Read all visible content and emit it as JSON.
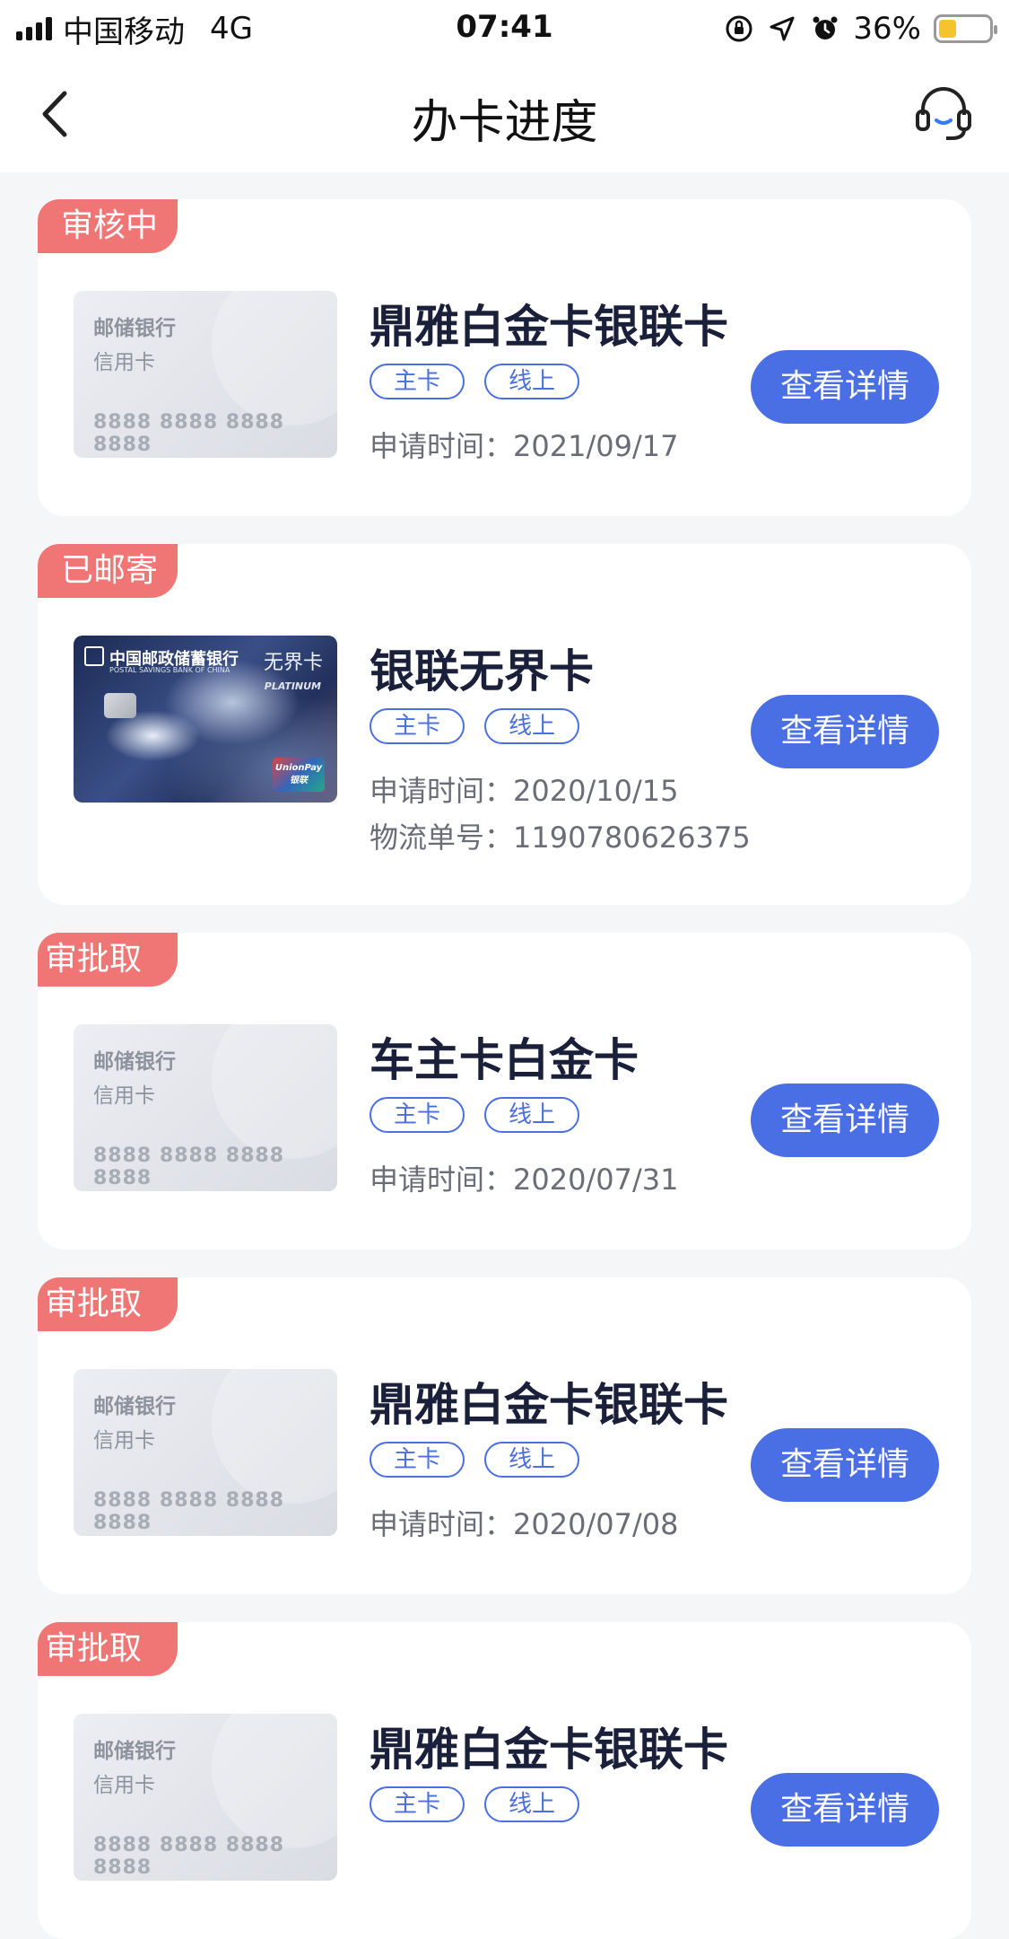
{
  "status_bar": {
    "carrier": "中国移动",
    "network": "4G",
    "time": "07:41",
    "battery": "36%",
    "battery_level": 0.36,
    "icons": [
      "orientation-lock-icon",
      "location-icon",
      "alarm-icon"
    ]
  },
  "nav": {
    "title": "办卡进度",
    "back_icon": "chevron-left-icon",
    "support_icon": "headset-icon"
  },
  "labels": {
    "apply_time": "申请时间：",
    "tracking_number": "物流单号："
  },
  "cards": [
    {
      "status": "审核中",
      "name": "鼎雅白金卡银联卡",
      "tags": [
        "主卡",
        "线上"
      ],
      "apply_time": "2021/09/17",
      "image": {
        "style": "placeholder",
        "bank": "邮储银行",
        "type": "信用卡",
        "number": "8888 8888 8888 8888"
      },
      "button": "查看详情"
    },
    {
      "status": "已邮寄",
      "name": "银联无界卡",
      "tags": [
        "主卡",
        "线上"
      ],
      "apply_time": "2020/10/15",
      "tracking_number": "1190780626375",
      "image": {
        "style": "art",
        "bank": "中国邮政储蓄银行",
        "bank_en": "POSTAL SAVINGS BANK OF CHINA",
        "card_name": "无界卡",
        "tier": "PLATINUM",
        "network": "UnionPay 银联"
      },
      "button": "查看详情"
    },
    {
      "status": "审批取消",
      "name": "车主卡白金卡",
      "tags": [
        "主卡",
        "线上"
      ],
      "apply_time": "2020/07/31",
      "image": {
        "style": "placeholder",
        "bank": "邮储银行",
        "type": "信用卡",
        "number": "8888 8888 8888 8888"
      },
      "button": "查看详情"
    },
    {
      "status": "审批取消",
      "name": "鼎雅白金卡银联卡",
      "tags": [
        "主卡",
        "线上"
      ],
      "apply_time": "2020/07/08",
      "image": {
        "style": "placeholder",
        "bank": "邮储银行",
        "type": "信用卡",
        "number": "8888 8888 8888 8888"
      },
      "button": "查看详情"
    },
    {
      "status": "审批取消",
      "name": "鼎雅白金卡银联卡",
      "tags": [
        "主卡",
        "线上"
      ],
      "image": {
        "style": "placeholder",
        "bank": "邮储银行",
        "type": "信用卡",
        "number": "8888 8888 8888 8888"
      },
      "button": "查看详情"
    }
  ],
  "colors": {
    "status_tag": "#f07575",
    "primary": "#4a6fe4",
    "background": "#f5f6f8"
  }
}
